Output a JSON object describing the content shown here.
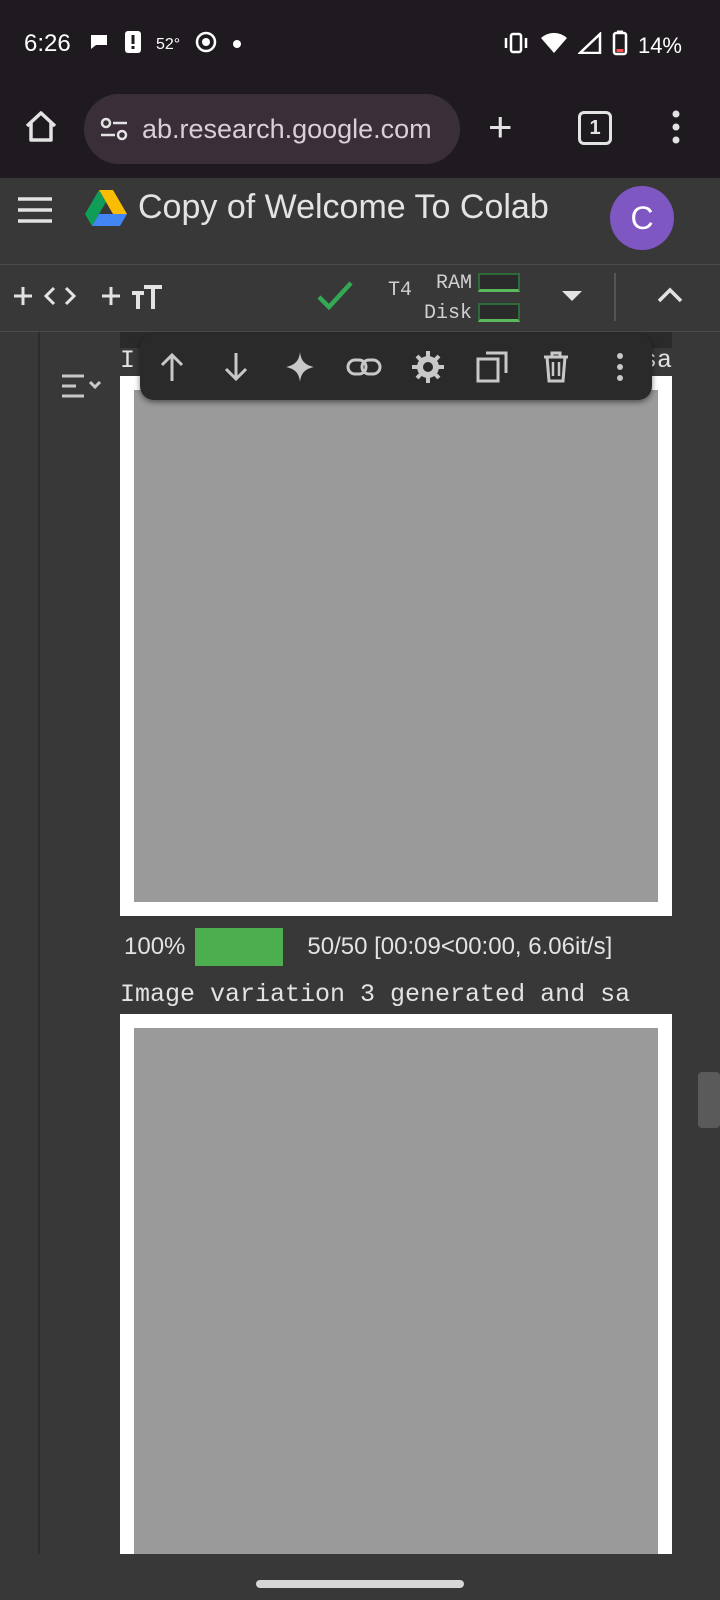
{
  "status": {
    "time": "6:26",
    "temp": "52°",
    "battery": "14%"
  },
  "browser": {
    "url": "ab.research.google.com",
    "tab_count": "1"
  },
  "colab": {
    "title": "Copy of Welcome To Colab",
    "avatar_letter": "C",
    "runtime": "T4",
    "ram_label": "RAM",
    "disk_label": "Disk"
  },
  "cell": {
    "line1_visible": "I",
    "line1_tail": "sa",
    "progress_pct": "100%",
    "progress_detail": "50/50  [00:09<00:00,    6.06it/s]",
    "variation_line": "Image variation 3 generated and sa"
  }
}
